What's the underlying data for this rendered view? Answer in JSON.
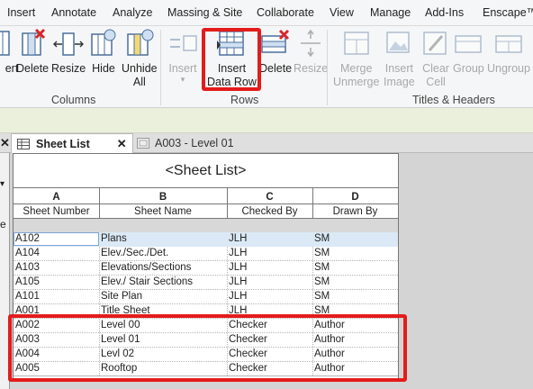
{
  "menu": [
    "Insert",
    "Annotate",
    "Analyze",
    "Massing & Site",
    "Collaborate",
    "View",
    "Manage",
    "Add-Ins",
    "Enscape™"
  ],
  "ribbon": {
    "columns_tools": [
      "ert",
      "Delete",
      "Resize",
      "Hide",
      "Unhide",
      "All"
    ],
    "rows_tools": {
      "insert": "Insert",
      "insert_data_row": [
        "Insert",
        "Data Row"
      ],
      "delete": "Delete",
      "resize": "Resize"
    },
    "titles_tools": [
      "Merge",
      "Unmerge",
      "Insert",
      "Image",
      "Clear",
      "Cell",
      "Group",
      "Ungroup"
    ],
    "groups": {
      "columns": "Columns",
      "rows": "Rows",
      "titles": "Titles & Headers"
    }
  },
  "tabs": {
    "active": "Sheet List",
    "other": "A003 - Level 01"
  },
  "left_strip_letter": "e",
  "schedule": {
    "title": "<Sheet List>",
    "col_letters": [
      "A",
      "B",
      "C",
      "D"
    ],
    "col_headers": [
      "Sheet Number",
      "Sheet Name",
      "Checked By",
      "Drawn By"
    ],
    "rows": [
      [
        "A102",
        "Plans",
        "JLH",
        "SM"
      ],
      [
        "A104",
        "Elev./Sec./Det.",
        "JLH",
        "SM"
      ],
      [
        "A103",
        "Elevations/Sections",
        "JLH",
        "SM"
      ],
      [
        "A105",
        "Elev./ Stair Sections",
        "JLH",
        "SM"
      ],
      [
        "A101",
        "Site Plan",
        "JLH",
        "SM"
      ],
      [
        "A001",
        "Title Sheet",
        "JLH",
        "SM"
      ],
      [
        "A002",
        "Level 00",
        "Checker",
        "Author"
      ],
      [
        "A003",
        "Level 01",
        "Checker",
        "Author"
      ],
      [
        "A004",
        "Levl 02",
        "Checker",
        "Author"
      ],
      [
        "A005",
        "Rooftop",
        "Checker",
        "Author"
      ]
    ]
  },
  "colors": {
    "highlight": "#e41b1b",
    "selected_row": "#dbe9f6",
    "options_bar": "#eaf0dc"
  }
}
